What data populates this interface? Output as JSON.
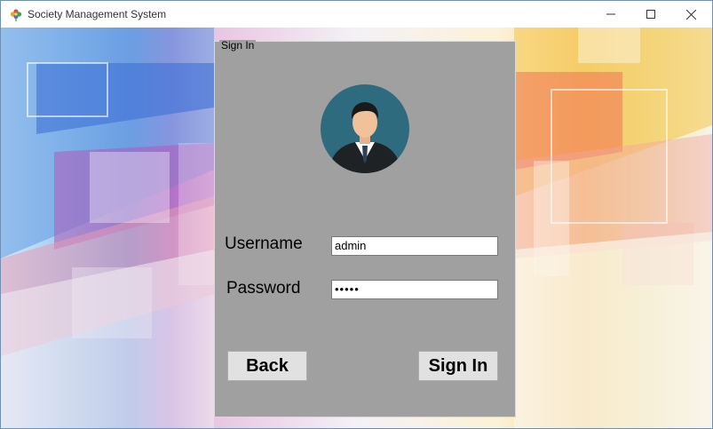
{
  "window": {
    "title": "Society Management System",
    "icons": {
      "app": "flower-app-icon",
      "minimize": "minimize-icon",
      "maximize": "maximize-icon",
      "close": "close-icon"
    }
  },
  "signin": {
    "group_title": "Sign In",
    "avatar_icon": "user-avatar-icon",
    "username_label": "Username",
    "username_value": "admin",
    "password_label": "Password",
    "password_value": "•••••",
    "back_label": "Back",
    "signin_label": "Sign In"
  },
  "colors": {
    "panel": "#a0a0a0",
    "avatar_circle": "#2f6b7f"
  }
}
